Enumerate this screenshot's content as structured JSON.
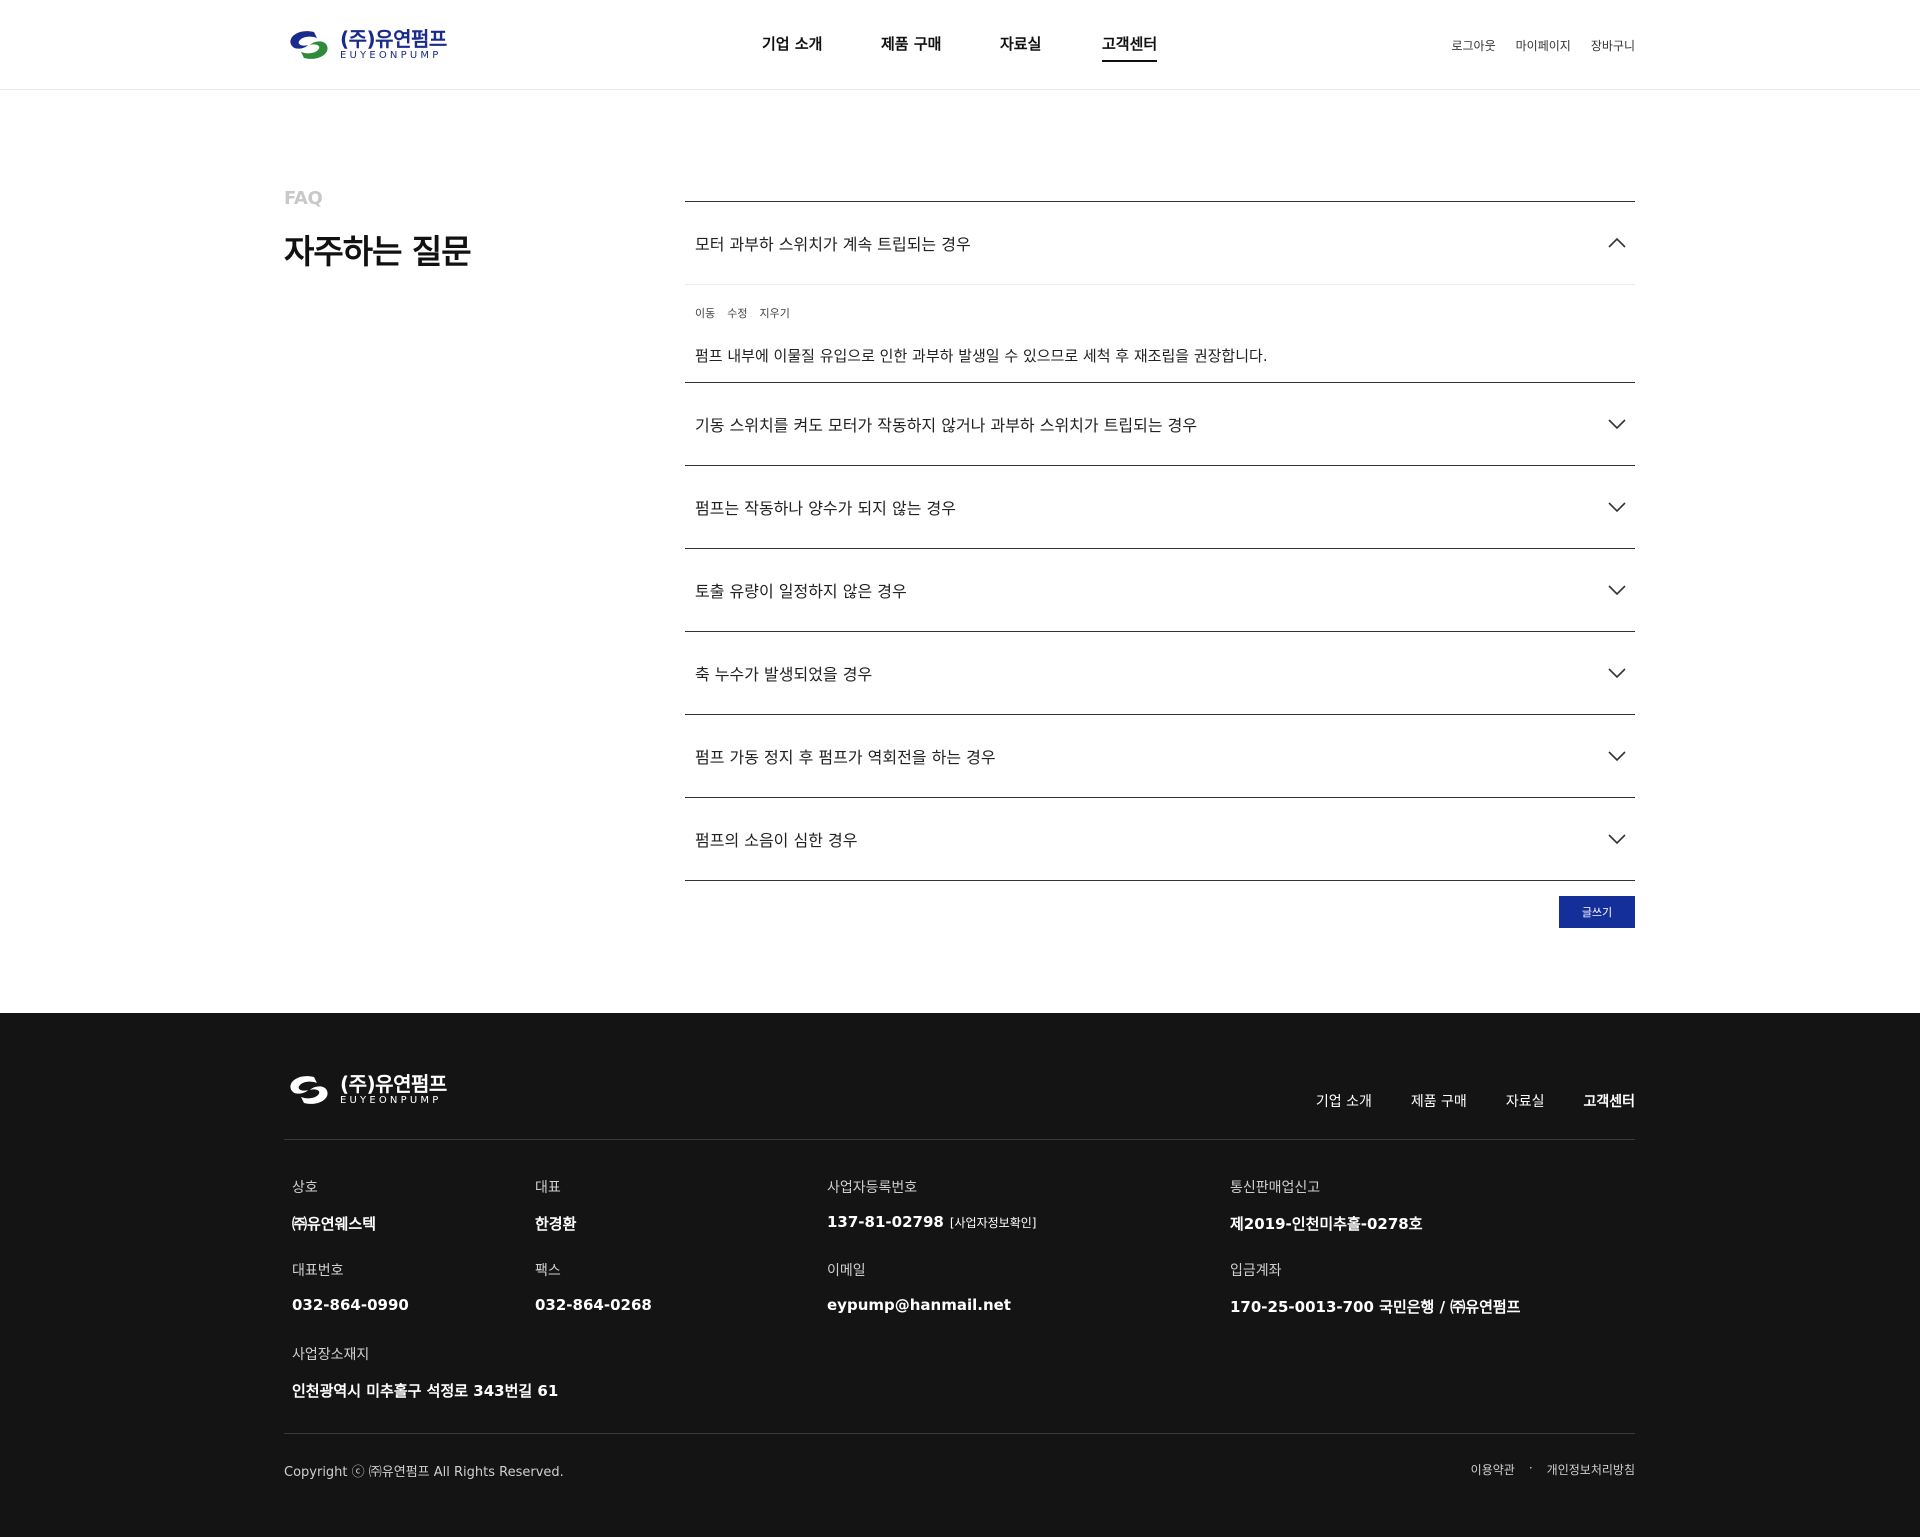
{
  "brand": {
    "name_kr": "(주)유연펌프",
    "name_en": "EUYEONPUMP",
    "color_primary": "#1a2b8c",
    "color_accent": "#2e8b3a"
  },
  "header": {
    "nav": [
      "기업 소개",
      "제품 구매",
      "자료실",
      "고객센터"
    ],
    "active_nav": "고객센터",
    "util": [
      "로그아웃",
      "마이페이지",
      "장바구니"
    ]
  },
  "faq": {
    "eyebrow": "FAQ",
    "title": "자주하는 질문",
    "items": [
      {
        "question": "모터 과부하 스위치가 계속 트립되는 경우",
        "open": true,
        "admin": [
          "이동",
          "수정",
          "지우기"
        ],
        "answer": "펌프 내부에 이물질 유입으로 인한 과부하 발생일 수 있으므로 세척 후 재조립을 권장합니다."
      },
      {
        "question": "기동 스위치를 켜도 모터가 작동하지 않거나 과부하 스위치가 트립되는 경우",
        "open": false
      },
      {
        "question": "펌프는 작동하나 양수가 되지 않는 경우",
        "open": false
      },
      {
        "question": "토출 유량이 일정하지 않은 경우",
        "open": false
      },
      {
        "question": "축 누수가 발생되었을 경우",
        "open": false
      },
      {
        "question": "펌프 가동 정지 후 펌프가 역회전을 하는 경우",
        "open": false
      },
      {
        "question": "펌프의 소음이 심한 경우",
        "open": false
      }
    ],
    "write_button": "글쓰기",
    "icons": {
      "open": "chevron-up-icon",
      "closed": "chevron-down-icon"
    }
  },
  "footer": {
    "nav": [
      "기업 소개",
      "제품 구매",
      "자료실",
      "고객센터"
    ],
    "info": {
      "company": {
        "label": "상호",
        "value": "㈜유연웨스텍"
      },
      "ceo": {
        "label": "대표",
        "value": "한경환"
      },
      "biz_no": {
        "label": "사업자등록번호",
        "value": "137-81-02798",
        "sub": "[사업자정보확인]"
      },
      "mail_order": {
        "label": "통신판매업신고",
        "value": "제2019-인천미추홀-0278호"
      },
      "phone": {
        "label": "대표번호",
        "value": "032-864-0990"
      },
      "fax": {
        "label": "팩스",
        "value": "032-864-0268"
      },
      "email": {
        "label": "이메일",
        "value": "eypump@hanmail.net"
      },
      "account": {
        "label": "입금계좌",
        "value": "170-25-0013-700 국민은행 / ㈜유연펌프"
      },
      "address": {
        "label": "사업장소재지",
        "value": "인천광역시 미추홀구 석정로 343번길 61"
      }
    },
    "copyright": "Copyright ⓒ ㈜유연펌프 All Rights Reserved.",
    "policy": [
      "이용약관",
      "·",
      "개인정보처리방침"
    ]
  }
}
